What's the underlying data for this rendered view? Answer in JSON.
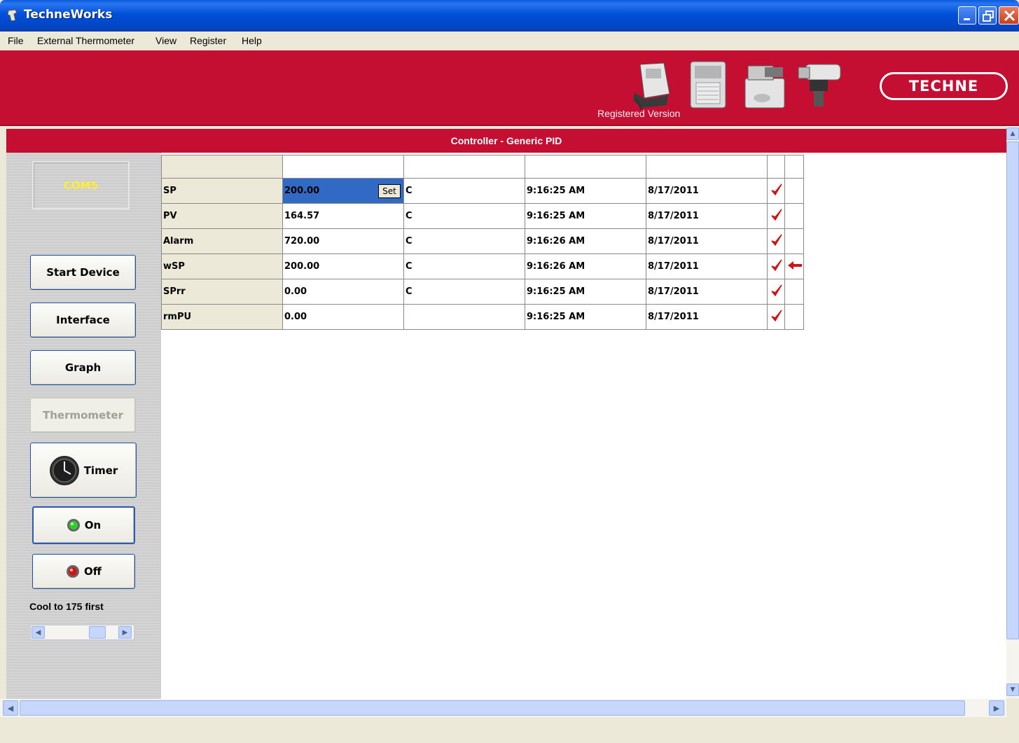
{
  "window": {
    "title": "TechneWorks",
    "title_icon": "techneworks-app-icon",
    "buttons": [
      "minimize",
      "restore",
      "close"
    ]
  },
  "menubar": {
    "items": [
      "File",
      "External Thermometer",
      "View",
      "Register",
      "Help"
    ]
  },
  "banner": {
    "registered_label": "Registered Version",
    "logo_text": "TECHNE",
    "background": "#c40f32"
  },
  "controller": {
    "title": "Controller - Generic PID"
  },
  "leftpanel": {
    "com_port": "COM5",
    "buttons": {
      "start_device": "Start Device",
      "interface": "Interface",
      "graph": "Graph",
      "thermometer": "Thermometer",
      "timer": "Timer",
      "on": "On",
      "off": "Off"
    },
    "cool_label": "Cool to 175 first",
    "scrollbar_position": 0.75
  },
  "grid": {
    "set_label": "Set",
    "rows": [
      {
        "name": "SP",
        "value": "200.00",
        "unit": "C",
        "time": "9:16:25 AM",
        "date": "8/17/2011",
        "checked": true,
        "arrow": false
      },
      {
        "name": "PV",
        "value": "164.57",
        "unit": "C",
        "time": "9:16:25 AM",
        "date": "8/17/2011",
        "checked": true,
        "arrow": false
      },
      {
        "name": "Alarm",
        "value": "720.00",
        "unit": "C",
        "time": "9:16:26 AM",
        "date": "8/17/2011",
        "checked": true,
        "arrow": false
      },
      {
        "name": "wSP",
        "value": "200.00",
        "unit": "C",
        "time": "9:16:26 AM",
        "date": "8/17/2011",
        "checked": true,
        "arrow": true
      },
      {
        "name": "SPrr",
        "value": "0.00",
        "unit": "C",
        "time": "9:16:25 AM",
        "date": "8/17/2011",
        "checked": true,
        "arrow": false
      },
      {
        "name": "rmPU",
        "value": "0.00",
        "unit": "",
        "time": "9:16:25 AM",
        "date": "8/17/2011",
        "checked": true,
        "arrow": false
      }
    ],
    "colors": {
      "check": "#d21414",
      "selection": "#316ac5"
    }
  }
}
